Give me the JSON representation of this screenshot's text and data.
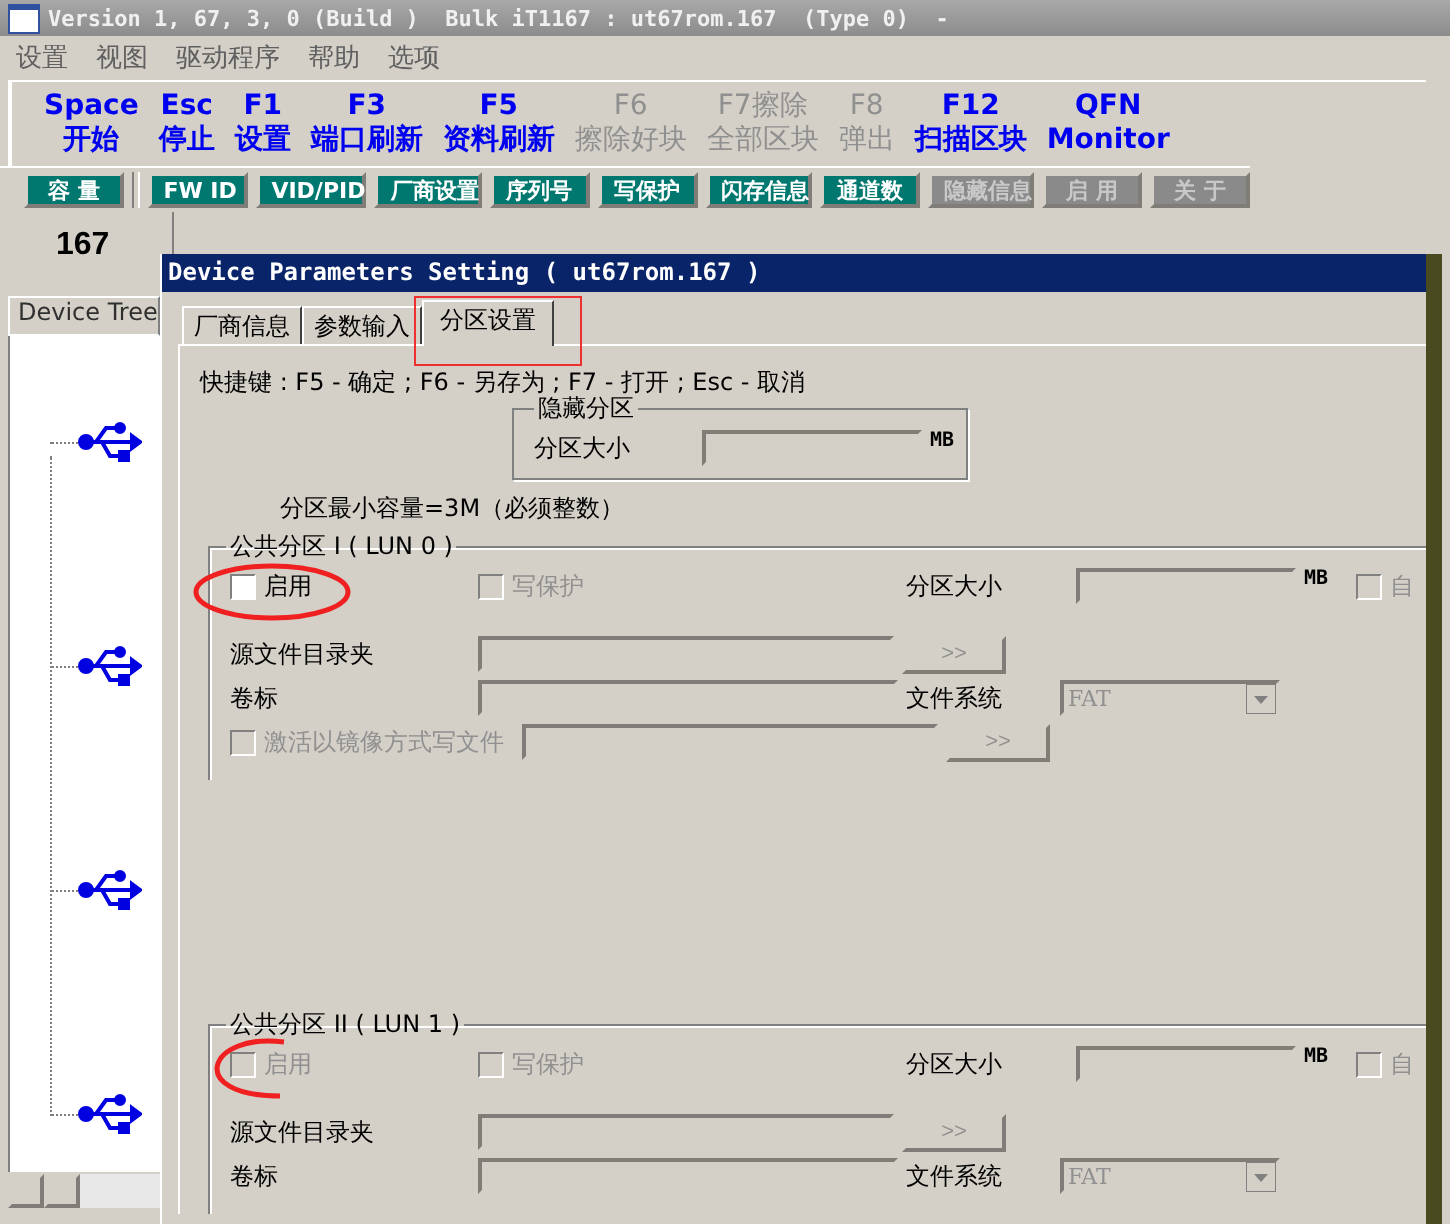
{
  "window": {
    "title": "Version 1, 67, 3, 0 (Build )  Bulk iT1167 : ut67rom.167  (Type 0)  -"
  },
  "menu": [
    "设置",
    "视图",
    "驱动程序",
    "帮助",
    "选项"
  ],
  "hotkeys": [
    {
      "key": "Space",
      "label": "开始",
      "disabled": false
    },
    {
      "key": "Esc",
      "label": "停止",
      "disabled": false
    },
    {
      "key": "F1",
      "label": "设置",
      "disabled": false
    },
    {
      "key": "F3",
      "label": "端口刷新",
      "disabled": false
    },
    {
      "key": "F5",
      "label": "资料刷新",
      "disabled": false
    },
    {
      "key": "F6",
      "label": "擦除好块",
      "disabled": true
    },
    {
      "key": "F7擦除",
      "label": "全部区块",
      "disabled": true
    },
    {
      "key": "F8",
      "label": "弹出",
      "disabled": true
    },
    {
      "key": "F12",
      "label": "扫描区块",
      "disabled": false
    },
    {
      "key": "QFN",
      "label": "Monitor",
      "disabled": false
    }
  ],
  "buttons": [
    {
      "label": "容 量",
      "disabled": false
    },
    {
      "label": "FW ID",
      "disabled": false
    },
    {
      "label": "VID/PID",
      "disabled": false
    },
    {
      "label": "厂商设置",
      "disabled": false
    },
    {
      "label": "序列号",
      "disabled": false
    },
    {
      "label": "写保护",
      "disabled": false
    },
    {
      "label": "闪存信息",
      "disabled": false
    },
    {
      "label": "通道数",
      "disabled": false
    },
    {
      "label": "隐藏信息",
      "disabled": true
    },
    {
      "label": "启 用",
      "disabled": true
    },
    {
      "label": "关 于",
      "disabled": true
    }
  ],
  "port_number": "167",
  "device_tree": {
    "tab": "Device Tree",
    "devices": [
      {
        "kind": "usb"
      },
      {
        "kind": "usb"
      },
      {
        "kind": "usb"
      },
      {
        "kind": "usb"
      }
    ]
  },
  "dialog": {
    "title": "Device Parameters Setting ( ut67rom.167 )",
    "tabs": [
      {
        "label": "厂商信息",
        "selected": false
      },
      {
        "label": "参数输入",
        "selected": false
      },
      {
        "label": "分区设置",
        "selected": true
      }
    ],
    "shortcut_hint": "快捷键 : F5 - 确定 ; F6 - 另存为 ; F7 - 打开 ; Esc - 取消",
    "hidden_partition": {
      "title": "隐藏分区",
      "size_label": "分区大小",
      "unit": "MB"
    },
    "min_note": "分区最小容量=3M（必须整数）",
    "partitions": [
      {
        "title": "公共分区 I ( LUN 0 )",
        "enable_label": "启用",
        "enable_checked": false,
        "enable_disabled": false,
        "write_protect_label": "写保护",
        "write_protect_disabled": true,
        "size_label": "分区大小",
        "unit": "MB",
        "auto_label": "自",
        "auto_checked": false,
        "source_label": "源文件目录夹",
        "browse": ">>",
        "volume_label": "卷标",
        "fs_label": "文件系统",
        "fs_value": "FAT",
        "mirror_label": "激活以镜像方式写文件",
        "mirror_checked": false,
        "mirror_browse": ">>"
      },
      {
        "title": "公共分区 II ( LUN 1 )",
        "enable_label": "启用",
        "enable_checked": false,
        "enable_disabled": true,
        "write_protect_label": "写保护",
        "write_protect_disabled": true,
        "size_label": "分区大小",
        "unit": "MB",
        "auto_label": "自",
        "auto_checked": false,
        "source_label": "源文件目录夹",
        "browse": ">>",
        "volume_label": "卷标",
        "fs_label": "文件系统",
        "fs_value": "FAT"
      }
    ]
  }
}
